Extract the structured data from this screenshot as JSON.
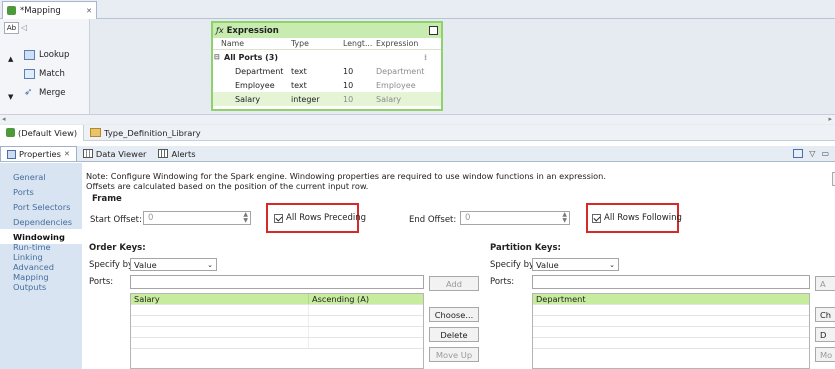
{
  "editor_tab": {
    "title": "*Mapping",
    "close": "✕"
  },
  "palette": {
    "items": [
      {
        "label": "Lookup",
        "icon": "lookup-icon"
      },
      {
        "label": "Match",
        "icon": "match-icon"
      },
      {
        "label": "Merge",
        "icon": "merge-icon"
      }
    ]
  },
  "expression": {
    "title": "Expression",
    "columns": {
      "name": "Name",
      "type": "Type",
      "length": "Lengt...",
      "expression": "Expression"
    },
    "group": "All Ports (3)",
    "ports": [
      {
        "name": "Department",
        "type": "text",
        "length": "10",
        "expression": "Department"
      },
      {
        "name": "Employee",
        "type": "text",
        "length": "10",
        "expression": "Employee"
      },
      {
        "name": "Salary",
        "type": "integer",
        "length": "10",
        "expression": "Salary"
      }
    ]
  },
  "view_tabs": [
    {
      "label": "(Default View)",
      "icon": "default-view-icon"
    },
    {
      "label": "Type_Definition_Library",
      "icon": "library-icon"
    }
  ],
  "properties_tabs": [
    {
      "label": "Properties",
      "active": true,
      "close": "✕"
    },
    {
      "label": "Data Viewer",
      "active": false
    },
    {
      "label": "Alerts",
      "active": false
    }
  ],
  "nav": {
    "items": [
      {
        "label": "General",
        "active": false
      },
      {
        "label": "Ports",
        "active": false
      },
      {
        "label": "Port Selectors",
        "active": false
      },
      {
        "label": "Dependencies",
        "active": false
      },
      {
        "label": "Windowing",
        "active": true
      },
      {
        "label": "Run-time Linking",
        "active": false
      },
      {
        "label": "Advanced",
        "active": false
      },
      {
        "label": "Mapping Outputs",
        "active": false
      }
    ]
  },
  "windowing": {
    "note_line1": "Note: Configure Windowing for the Spark engine. Windowing properties are required to use window functions in an expression.",
    "note_line2": "Offsets are calculated based on the position of the current input row.",
    "frame_label": "Frame",
    "start_offset_label": "Start Offset:",
    "start_offset_value": "0",
    "all_rows_preceding": "All Rows Preceding",
    "end_offset_label": "End Offset:",
    "end_offset_value": "0",
    "all_rows_following": "All Rows Following",
    "order_keys": {
      "title": "Order Keys:",
      "specify_by_label": "Specify by:",
      "specify_by_value": "Value",
      "ports_label": "Ports:",
      "add": "Add",
      "row": {
        "port": "Salary",
        "order": "Ascending (A)"
      },
      "choose": "Choose...",
      "delete": "Delete",
      "move_up": "Move Up"
    },
    "partition_keys": {
      "title": "Partition Keys:",
      "specify_by_label": "Specify by:",
      "specify_by_value": "Value",
      "ports_label": "Ports:",
      "row": "Department",
      "choose_partial": "Ch",
      "delete_partial": "D",
      "move_partial": "Mo",
      "add_partial": "A"
    }
  },
  "colors": {
    "accent_green": "#8fd16b",
    "highlight_red": "#d42a2a",
    "nav_bg": "#d8e4f1",
    "selected_row": "#c8ec9e"
  }
}
